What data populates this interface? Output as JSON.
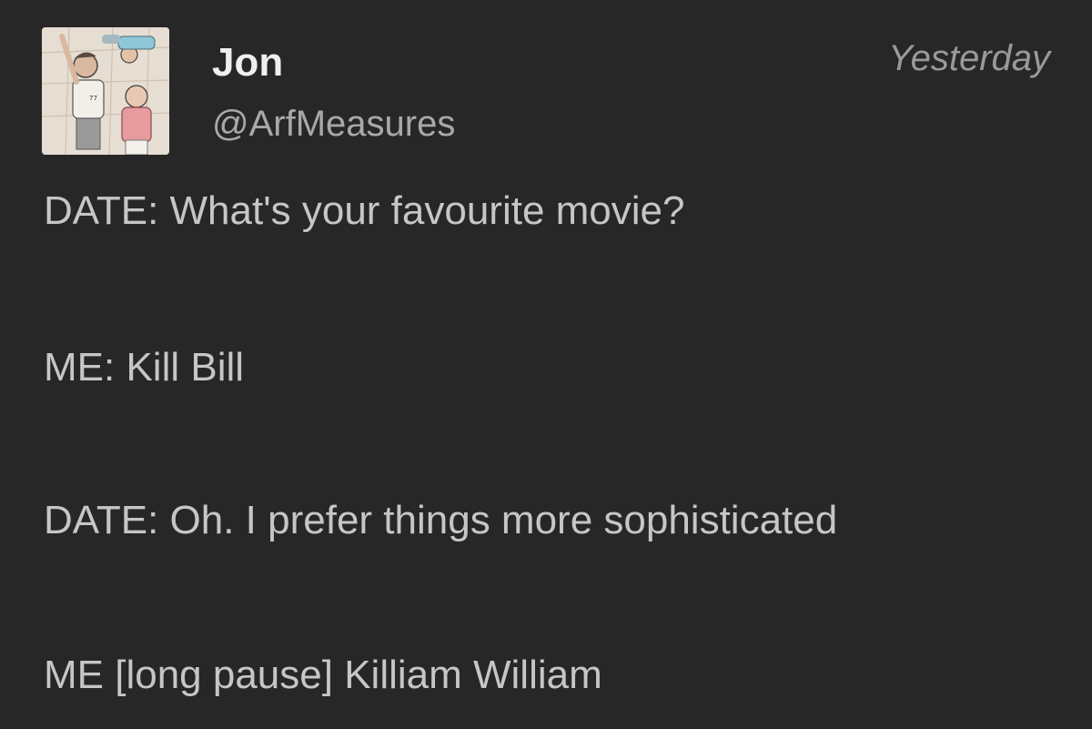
{
  "tweet": {
    "author": {
      "display_name": "Jon",
      "handle": "@ArfMeasures"
    },
    "timestamp": "Yesterday",
    "lines": [
      "DATE: What's your favourite movie?",
      "ME: Kill Bill",
      "DATE: Oh. I prefer things more sophisticated",
      "ME [long pause] Killiam William"
    ]
  },
  "colors": {
    "background": "#272727",
    "name": "#efefef",
    "handle": "#a9a9a9",
    "timestamp": "#9a9a9a",
    "body_text": "#c6c6c6"
  }
}
